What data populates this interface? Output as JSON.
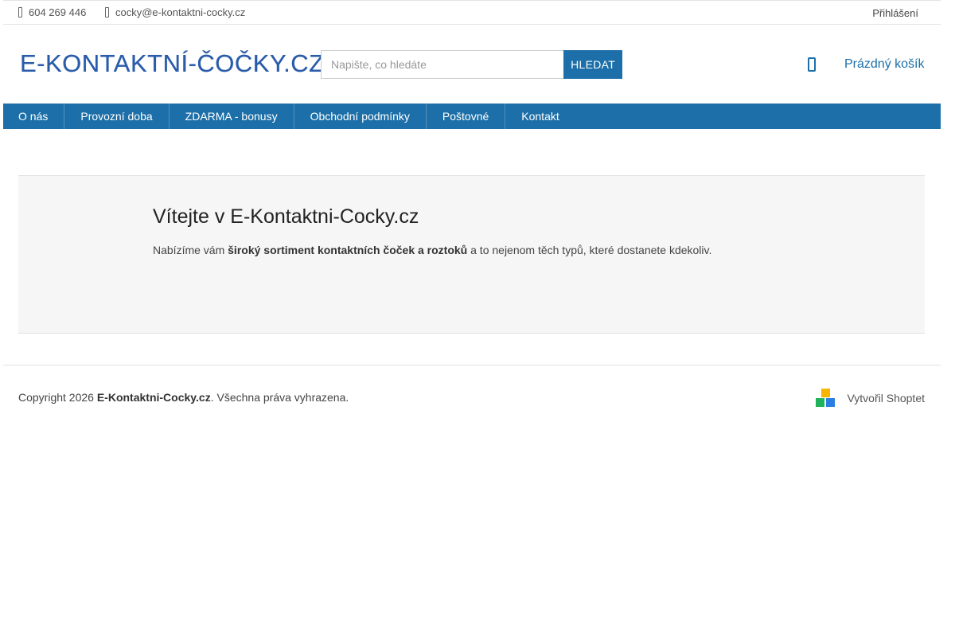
{
  "topbar": {
    "phone": "604 269 446",
    "email": "cocky@e-kontaktni-cocky.cz",
    "login": "Přihlášení"
  },
  "header": {
    "logo_text": "E-KONTAKTNÍ-ČOČKY.CZ",
    "search": {
      "placeholder": "Napište, co hledáte",
      "button": "HLEDAT"
    },
    "cart": {
      "icon": "cart-icon",
      "label": "Prázdný košík"
    }
  },
  "nav": {
    "items": [
      {
        "label": "O nás"
      },
      {
        "label": "Provozní doba"
      },
      {
        "label": "ZDARMA - bonusy"
      },
      {
        "label": "Obchodní podmínky"
      },
      {
        "label": "Poštovné"
      },
      {
        "label": "Kontakt"
      }
    ]
  },
  "main": {
    "title": "Vítejte v E-Kontaktni-Cocky.cz",
    "text_before": "Nabízíme vám ",
    "text_bold": "široký sortiment kontaktních čoček a roztoků",
    "text_after": " a to nejenom těch typů, které dostanete kdekoliv."
  },
  "footer": {
    "copyright_prefix": "Copyright 2026 ",
    "copyright_brand": "E-Kontaktni-Cocky.cz",
    "copyright_suffix": ". Všechna práva vyhrazena.",
    "credit": "Vytvořil Shoptet"
  },
  "colors": {
    "accent": "#1c6fa8",
    "logo": "#2a5caa",
    "content_bg": "#f6f6f6"
  }
}
